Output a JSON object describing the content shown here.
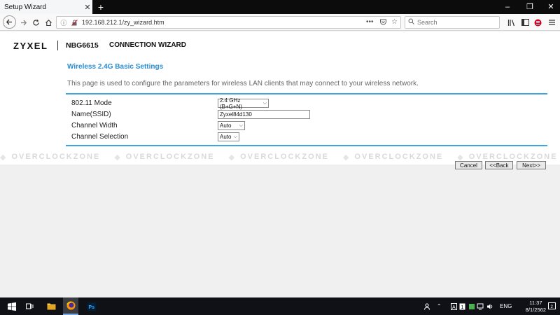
{
  "browser": {
    "tab_title": "Setup Wizard",
    "url": "192.168.212.1/zy_wizard.htm",
    "search_placeholder": "Search",
    "icons": [
      "back-arrow-icon",
      "forward-arrow-icon",
      "reload-icon",
      "home-icon",
      "info-icon",
      "lock-icon",
      "more-icon",
      "pocket-icon",
      "star-icon",
      "search-icon",
      "library-icon",
      "sidebar-icon",
      "addon-icon",
      "menu-icon"
    ]
  },
  "header": {
    "brand": "ZYXEL",
    "model": "NBG6615",
    "wizard_title": "CONNECTION WIZARD"
  },
  "section": {
    "title": "Wireless 2.4G Basic Settings",
    "description": "This page is used to configure the parameters for wireless LAN clients that may connect to your wireless network."
  },
  "form": {
    "mode_label": "802.11 Mode",
    "mode_value": "2.4 GHz (B+G+N)",
    "ssid_label": "Name(SSID)",
    "ssid_value": "Zyxel84d130",
    "width_label": "Channel Width",
    "width_value": "Auto",
    "channel_label": "Channel Selection",
    "channel_value": "Auto"
  },
  "watermark": "OVERCLOCKZONE",
  "buttons": {
    "cancel": "Cancel",
    "back": "<<Back",
    "next": "Next>>"
  },
  "taskbar": {
    "language": "ENG",
    "time": "11:37",
    "date": "8/1/2562",
    "notification_count": "2"
  }
}
